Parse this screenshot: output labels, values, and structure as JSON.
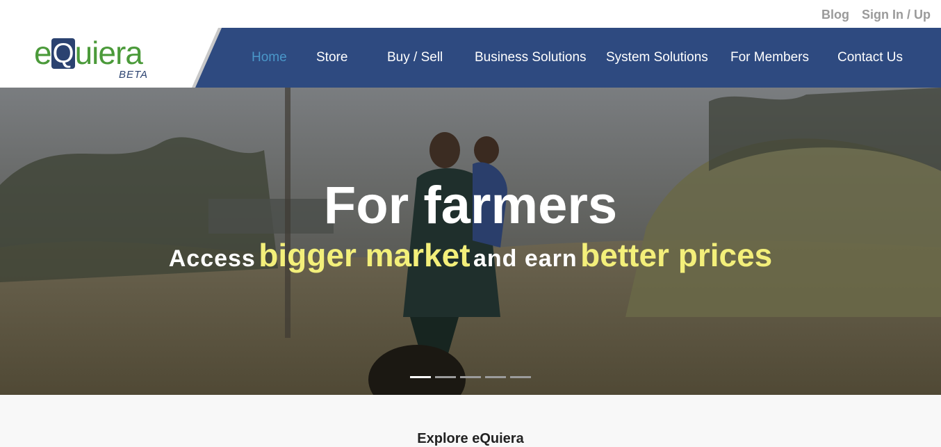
{
  "top_links": {
    "blog": "Blog",
    "sign_in": "Sign In / Up"
  },
  "logo": {
    "e": "e",
    "q": "Q",
    "rest": "uiera",
    "beta": "BETA"
  },
  "nav": {
    "home": "Home",
    "store": "Store",
    "buy_sell": "Buy / Sell",
    "business": "Business Solutions",
    "system": "System Solutions",
    "members": "For Members",
    "contact": "Contact Us"
  },
  "hero": {
    "title": "For farmers",
    "sub_1": "Access",
    "sub_2": "bigger market",
    "sub_3": "and earn",
    "sub_4": "better prices"
  },
  "carousel": {
    "slide_count": 5,
    "active_index": 0
  },
  "section": {
    "heading": "Explore eQuiera"
  },
  "colors": {
    "nav_bg": "#2e4a80",
    "accent_green": "#4b9a3a",
    "highlight_yellow": "#f3ef7a",
    "active_nav": "#4a97c9"
  }
}
